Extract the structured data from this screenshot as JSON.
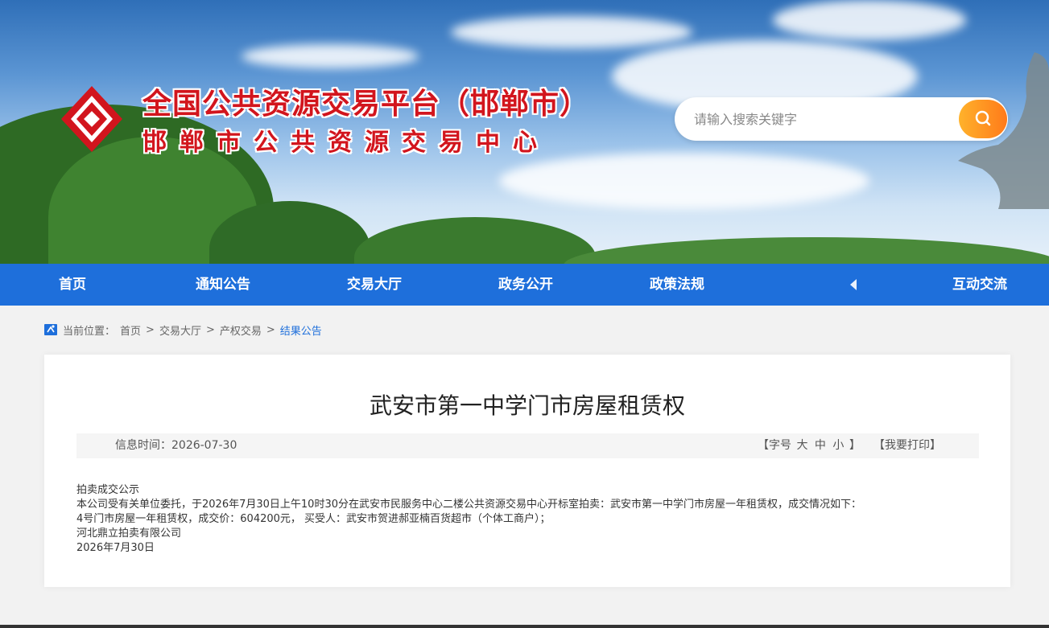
{
  "site": {
    "title_main": "全国公共资源交易平台（邯郸市）",
    "title_sub": "邯郸市公共资源交易中心",
    "brand_color": "#d2151d"
  },
  "search": {
    "placeholder": "请输入搜索关键字"
  },
  "nav": {
    "items": [
      {
        "label": "首页"
      },
      {
        "label": "通知公告"
      },
      {
        "label": "交易大厅"
      },
      {
        "label": "政务公开"
      },
      {
        "label": "政策法规"
      },
      {
        "label": "互动交流"
      }
    ],
    "accent": "#1e6fdb"
  },
  "breadcrumb": {
    "prefix": "当前位置：",
    "items": [
      "首页",
      "交易大厅",
      "产权交易",
      "结果公告"
    ],
    "separator": ">"
  },
  "article": {
    "title": "武安市第一中学门市房屋租赁权",
    "meta": {
      "date_text": "信息时间：2026-07-30",
      "font_label_open": "【字号",
      "font_large": "大",
      "font_medium": "中",
      "font_small": "小",
      "font_label_close": "】",
      "print_label": "【我要打印】"
    },
    "body": [
      "拍卖成交公示",
      "本公司受有关单位委托，于2026年7月30日上午10时30分在武安市民服务中心二楼公共资源交易中心开标室拍卖：武安市第一中学门市房屋一年租赁权，成交情况如下：",
      "4号门市房屋一年租赁权，成交价：604200元， 买受人：武安市贺进郝亚楠百货超市（个体工商户）；",
      "河北鼎立拍卖有限公司",
      "2026年7月30日"
    ]
  }
}
